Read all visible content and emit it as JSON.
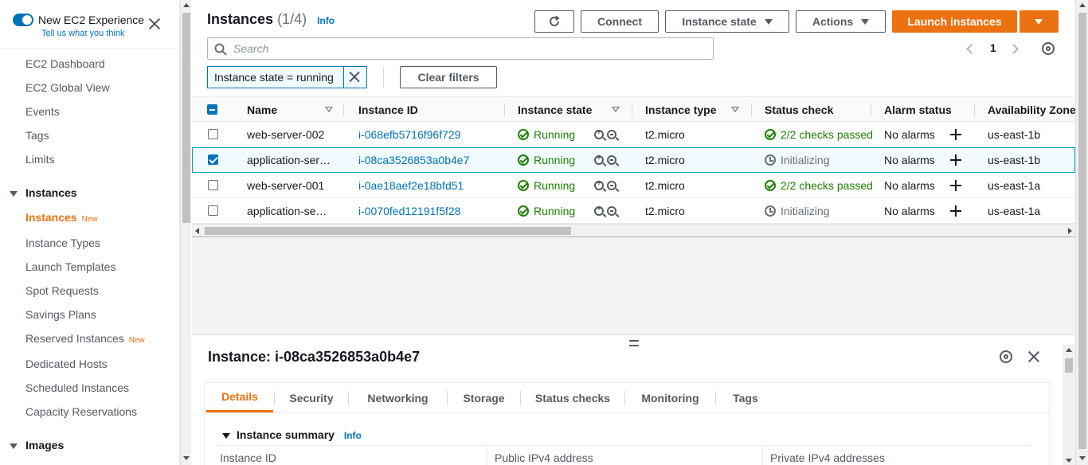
{
  "sidebar": {
    "new_experience": {
      "title": "New EC2 Experience",
      "subtitle": "Tell us what you think"
    },
    "top_items": [
      "EC2 Dashboard",
      "EC2 Global View",
      "Events",
      "Tags",
      "Limits"
    ],
    "sections": [
      {
        "title": "Instances",
        "items": [
          {
            "label": "Instances",
            "badge": "New",
            "active": true
          },
          {
            "label": "Instance Types",
            "badge": ""
          },
          {
            "label": "Launch Templates",
            "badge": ""
          },
          {
            "label": "Spot Requests",
            "badge": ""
          },
          {
            "label": "Savings Plans",
            "badge": ""
          },
          {
            "label": "Reserved Instances",
            "badge": "New"
          },
          {
            "label": "Dedicated Hosts",
            "badge": ""
          },
          {
            "label": "Scheduled Instances",
            "badge": ""
          },
          {
            "label": "Capacity Reservations",
            "badge": ""
          }
        ]
      },
      {
        "title": "Images",
        "items": []
      }
    ]
  },
  "header": {
    "title": "Instances",
    "count": "(1/4)",
    "info": "Info",
    "buttons": {
      "connect": "Connect",
      "instance_state": "Instance state",
      "actions": "Actions",
      "launch": "Launch instances"
    }
  },
  "search": {
    "placeholder": "Search"
  },
  "pagination": {
    "current_page": "1"
  },
  "filter": {
    "token": "Instance state = running",
    "clear": "Clear filters"
  },
  "table": {
    "columns": [
      "Name",
      "Instance ID",
      "Instance state",
      "Instance type",
      "Status check",
      "Alarm status",
      "Availability Zone"
    ],
    "rows": [
      {
        "name": "web-server-002",
        "id": "i-068efb5716f96f729",
        "state": "Running",
        "type": "t2.micro",
        "status": "2/2 checks passed",
        "status_ok": true,
        "alarm": "No alarms",
        "az": "us-east-1b",
        "selected": false
      },
      {
        "name": "application-ser…",
        "id": "i-08ca3526853a0b4e7",
        "state": "Running",
        "type": "t2.micro",
        "status": "Initializing",
        "status_ok": false,
        "alarm": "No alarms",
        "az": "us-east-1b",
        "selected": true
      },
      {
        "name": "web-server-001",
        "id": "i-0ae18aef2e18bfd51",
        "state": "Running",
        "type": "t2.micro",
        "status": "2/2 checks passed",
        "status_ok": true,
        "alarm": "No alarms",
        "az": "us-east-1a",
        "selected": false
      },
      {
        "name": "application-se…",
        "id": "i-0070fed12191f5f28",
        "state": "Running",
        "type": "t2.micro",
        "status": "Initializing",
        "status_ok": false,
        "alarm": "No alarms",
        "az": "us-east-1a",
        "selected": false
      }
    ]
  },
  "detail": {
    "title": "Instance: i-08ca3526853a0b4e7",
    "tabs": [
      "Details",
      "Security",
      "Networking",
      "Storage",
      "Status checks",
      "Monitoring",
      "Tags"
    ],
    "active_tab": "Details",
    "summary_title": "Instance summary",
    "summary_info": "Info",
    "fields": [
      "Instance ID",
      "Public IPv4 address",
      "Private IPv4 addresses"
    ]
  },
  "colors": {
    "accent": "#ec7211",
    "link": "#0073bb",
    "success": "#1d8102"
  }
}
